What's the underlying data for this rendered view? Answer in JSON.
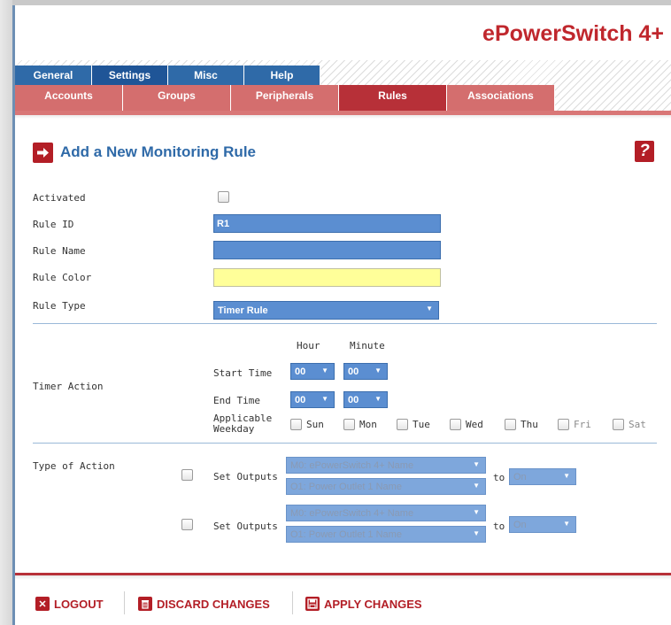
{
  "brand": {
    "part1": "ePower",
    "part2": "Switch 4+"
  },
  "tabs_main": [
    {
      "label": "General"
    },
    {
      "label": "Settings"
    },
    {
      "label": "Misc"
    },
    {
      "label": "Help"
    }
  ],
  "tabs_sub": [
    {
      "label": "Accounts"
    },
    {
      "label": "Groups"
    },
    {
      "label": "Peripherals"
    },
    {
      "label": "Rules"
    },
    {
      "label": "Associations"
    }
  ],
  "page": {
    "title": "Add a New Monitoring Rule",
    "help_glyph": "?"
  },
  "form": {
    "activated_label": "Activated",
    "rule_id_label": "Rule ID",
    "rule_id_value": "R1",
    "rule_name_label": "Rule Name",
    "rule_name_value": "",
    "rule_color_label": "Rule Color",
    "rule_color_value": "#ffff99",
    "rule_type_label": "Rule Type",
    "rule_type_value": "Timer Rule"
  },
  "timer": {
    "section_label": "Timer Action",
    "hour_header": "Hour",
    "minute_header": "Minute",
    "start_label": "Start Time",
    "end_label": "End Time",
    "start_hour": "00",
    "start_minute": "00",
    "end_hour": "00",
    "end_minute": "00",
    "weekday_label_line1": "Applicable",
    "weekday_label_line2": "Weekday",
    "days": [
      "Sun",
      "Mon",
      "Tue",
      "Wed",
      "Thu",
      "Fri",
      "Sat"
    ]
  },
  "action": {
    "section_label": "Type of Action",
    "rows": [
      {
        "label": "Set Outputs",
        "select1": "M0: ePowerSwitch 4+ Name",
        "select2": "O1: Power Outlet 1 Name",
        "to": "to",
        "state": "On"
      },
      {
        "label": "Set Outputs",
        "select1": "M0: ePowerSwitch 4+ Name",
        "select2": "O1: Power Outlet 1 Name",
        "to": "to",
        "state": "On"
      }
    ]
  },
  "footer": {
    "logout": "LOGOUT",
    "discard": "DISCARD CHANGES",
    "apply": "APPLY CHANGES"
  },
  "colors": {
    "accent_blue": "#2f6aa8",
    "accent_red": "#b31e26",
    "field_blue": "#5b8ed1"
  }
}
